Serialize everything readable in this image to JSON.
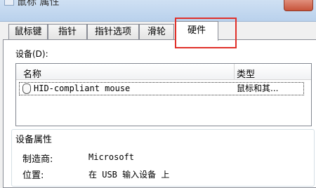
{
  "window": {
    "title": "鼠标 属性"
  },
  "tabs": [
    {
      "label": "鼠标键",
      "active": false
    },
    {
      "label": "指针",
      "active": false
    },
    {
      "label": "指针选项",
      "active": false
    },
    {
      "label": "滑轮",
      "active": false
    },
    {
      "label": "硬件",
      "active": true
    }
  ],
  "devices": {
    "label": "设备(D):",
    "columns": [
      "名称",
      "类型"
    ],
    "rows": [
      {
        "name": "HID-compliant mouse",
        "type": "鼠标和其...",
        "icon": "mouse-icon",
        "selected": true
      }
    ]
  },
  "properties": {
    "title": "设备属性",
    "manufacturer_label": "制造商:",
    "manufacturer_value": "Microsoft",
    "location_label": "位置:",
    "location_value": "在 USB 输入设备 上"
  },
  "colors": {
    "highlight_box": "#e0302a"
  }
}
